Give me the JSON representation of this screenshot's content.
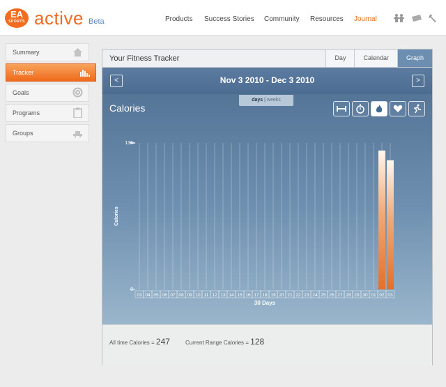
{
  "brand": {
    "logo_text": "EA",
    "logo_subtext": "SPORTS",
    "name": "active",
    "tag": "Beta"
  },
  "topnav": [
    {
      "label": "Products",
      "active": false
    },
    {
      "label": "Success Stories",
      "active": false
    },
    {
      "label": "Community",
      "active": false
    },
    {
      "label": "Resources",
      "active": false
    },
    {
      "label": "Journal",
      "active": true
    }
  ],
  "header_icons": [
    "people-icon",
    "card-icon",
    "wrench-icon"
  ],
  "sidebar": {
    "items": [
      {
        "label": "Summary",
        "icon": "home-icon",
        "active": false
      },
      {
        "label": "Tracker",
        "icon": "bar-chart-icon",
        "active": true
      },
      {
        "label": "Goals",
        "icon": "target-icon",
        "active": false
      },
      {
        "label": "Programs",
        "icon": "clipboard-icon",
        "active": false
      },
      {
        "label": "Groups",
        "icon": "group-icon",
        "active": false
      }
    ]
  },
  "tracker": {
    "title": "Your Fitness Tracker",
    "tabs": [
      {
        "label": "Day",
        "selected": false
      },
      {
        "label": "Calendar",
        "selected": false
      },
      {
        "label": "Graph",
        "selected": true
      }
    ],
    "prev": "<",
    "next": ">",
    "date_range": "Nov 3 2010 - Dec 3 2010",
    "toggle": {
      "days": "days",
      "sep": "|",
      "weeks": "weeks"
    },
    "metric": "Calories",
    "metric_buttons": [
      {
        "icon": "dumbbell-icon",
        "selected": false
      },
      {
        "icon": "stopwatch-icon",
        "selected": false
      },
      {
        "icon": "flame-icon",
        "selected": true
      },
      {
        "icon": "heart-icon",
        "selected": false
      },
      {
        "icon": "runner-icon",
        "selected": false
      }
    ],
    "colors": {
      "bar": "#e3702a",
      "accent": "#ee6a23"
    }
  },
  "chart_data": {
    "type": "bar",
    "categories": [
      "03",
      "04",
      "05",
      "06",
      "07",
      "08",
      "09",
      "10",
      "11",
      "12",
      "13",
      "14",
      "15",
      "16",
      "17",
      "18",
      "19",
      "20",
      "21",
      "22",
      "23",
      "24",
      "25",
      "26",
      "27",
      "28",
      "29",
      "30",
      "01",
      "02",
      "03"
    ],
    "values": [
      0,
      0,
      0,
      0,
      0,
      0,
      0,
      0,
      0,
      0,
      0,
      0,
      0,
      0,
      0,
      0,
      0,
      0,
      0,
      0,
      0,
      0,
      0,
      0,
      0,
      0,
      0,
      0,
      0,
      128,
      119
    ],
    "xlabel": "30 Days",
    "ylabel": "Calories",
    "ylim": [
      0,
      135
    ],
    "yticks": [
      "135",
      "0"
    ],
    "grid": true
  },
  "stats": {
    "all_time_label": "All time Calories =",
    "all_time_value": "247",
    "range_label": "Current Range Calories =",
    "range_value": "128"
  }
}
